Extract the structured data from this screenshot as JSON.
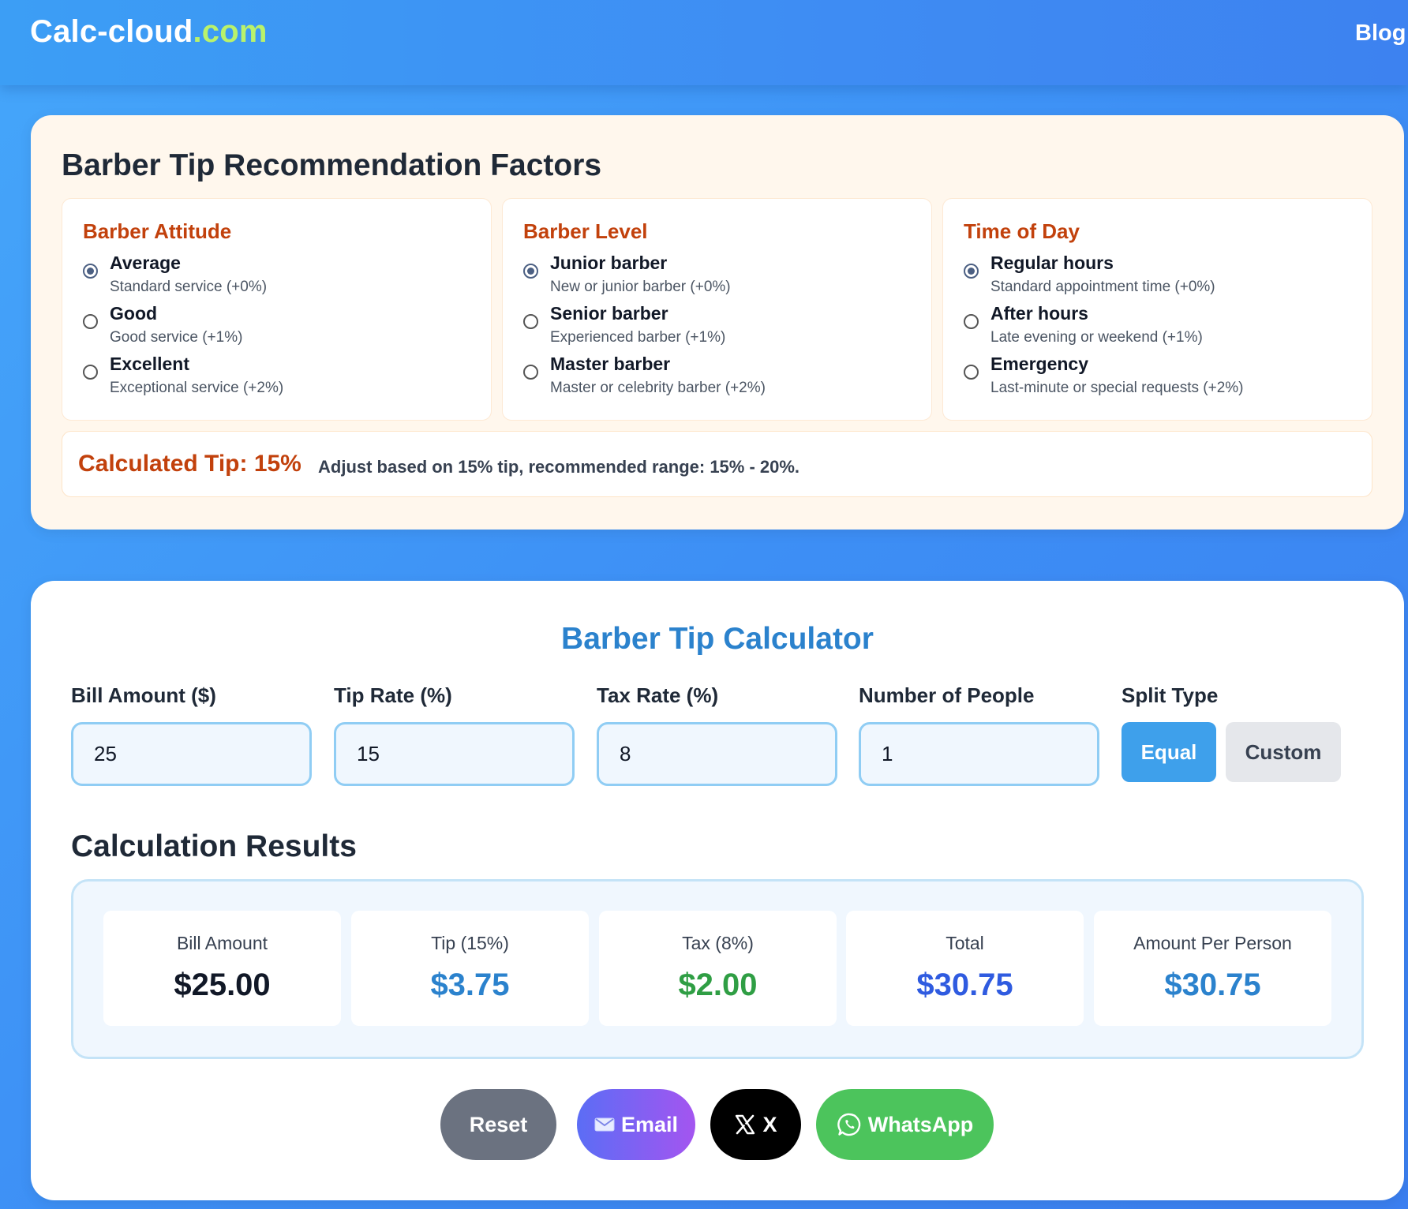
{
  "header": {
    "brand_main": "Calc-cloud",
    "brand_tld": ".com",
    "nav_blog": "Blog"
  },
  "factors": {
    "title": "Barber Tip Recommendation Factors",
    "groups": [
      {
        "heading": "Barber Attitude",
        "options": [
          {
            "label": "Average",
            "desc": "Standard service (+0%)",
            "checked": true
          },
          {
            "label": "Good",
            "desc": "Good service (+1%)",
            "checked": false
          },
          {
            "label": "Excellent",
            "desc": "Exceptional service (+2%)",
            "checked": false
          }
        ]
      },
      {
        "heading": "Barber Level",
        "options": [
          {
            "label": "Junior barber",
            "desc": "New or junior barber (+0%)",
            "checked": true
          },
          {
            "label": "Senior barber",
            "desc": "Experienced barber (+1%)",
            "checked": false
          },
          {
            "label": "Master barber",
            "desc": "Master or celebrity barber (+2%)",
            "checked": false
          }
        ]
      },
      {
        "heading": "Time of Day",
        "options": [
          {
            "label": "Regular hours",
            "desc": "Standard appointment time (+0%)",
            "checked": true
          },
          {
            "label": "After hours",
            "desc": "Late evening or weekend (+1%)",
            "checked": false
          },
          {
            "label": "Emergency",
            "desc": "Last-minute or special requests (+2%)",
            "checked": false
          }
        ]
      }
    ],
    "calculated_tip": "Calculated Tip: 15%",
    "calculated_note": "Adjust based on 15% tip, recommended range: 15% - 20%."
  },
  "calculator": {
    "title": "Barber Tip Calculator",
    "fields": [
      {
        "label": "Bill Amount ($)",
        "value": "25"
      },
      {
        "label": "Tip Rate (%)",
        "value": "15"
      },
      {
        "label": "Tax Rate (%)",
        "value": "8"
      },
      {
        "label": "Number of People",
        "value": "1"
      }
    ],
    "split": {
      "label": "Split Type",
      "equal": "Equal",
      "custom": "Custom",
      "selected": "Equal"
    },
    "results_title": "Calculation Results",
    "results": [
      {
        "label": "Bill Amount",
        "value": "$25.00",
        "color": "#111827"
      },
      {
        "label": "Tip (15%)",
        "value": "$3.75",
        "color": "#2b82cd"
      },
      {
        "label": "Tax (8%)",
        "value": "$2.00",
        "color": "#2f9e44"
      },
      {
        "label": "Total",
        "value": "$30.75",
        "color": "#2f5be0"
      },
      {
        "label": "Amount Per Person",
        "value": "$30.75",
        "color": "#2b82cd"
      }
    ],
    "actions": {
      "reset": "Reset",
      "email": "Email",
      "email_icon": "envelope-icon",
      "x": "X",
      "x_icon": "x-logo-icon",
      "whatsapp": "WhatsApp",
      "whatsapp_icon": "whatsapp-icon"
    }
  },
  "colors": {
    "accent_orange": "#c2410c",
    "accent_blue": "#2b82cd",
    "equal_button": "#3ea0eb",
    "whatsapp_green": "#4cc45c"
  }
}
